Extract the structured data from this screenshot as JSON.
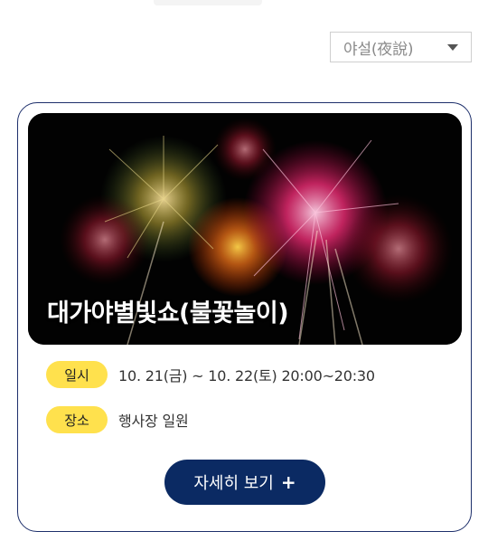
{
  "filter": {
    "selected": "야설(夜說)",
    "icon": "caret-down-icon"
  },
  "event": {
    "title": "대가야별빛쇼(불꽃놀이)",
    "image_icon": "fireworks-image",
    "date_label": "일시",
    "date_value": "10. 21(금) ~ 10. 22(토) 20:00~20:30",
    "place_label": "장소",
    "place_value": "행사장 일원",
    "more_label": "자세히 보기",
    "more_icon": "plus-icon"
  },
  "colors": {
    "accent_navy": "#0b2a63",
    "pill_yellow": "#ffe14d",
    "card_border": "#1d2f6b"
  }
}
